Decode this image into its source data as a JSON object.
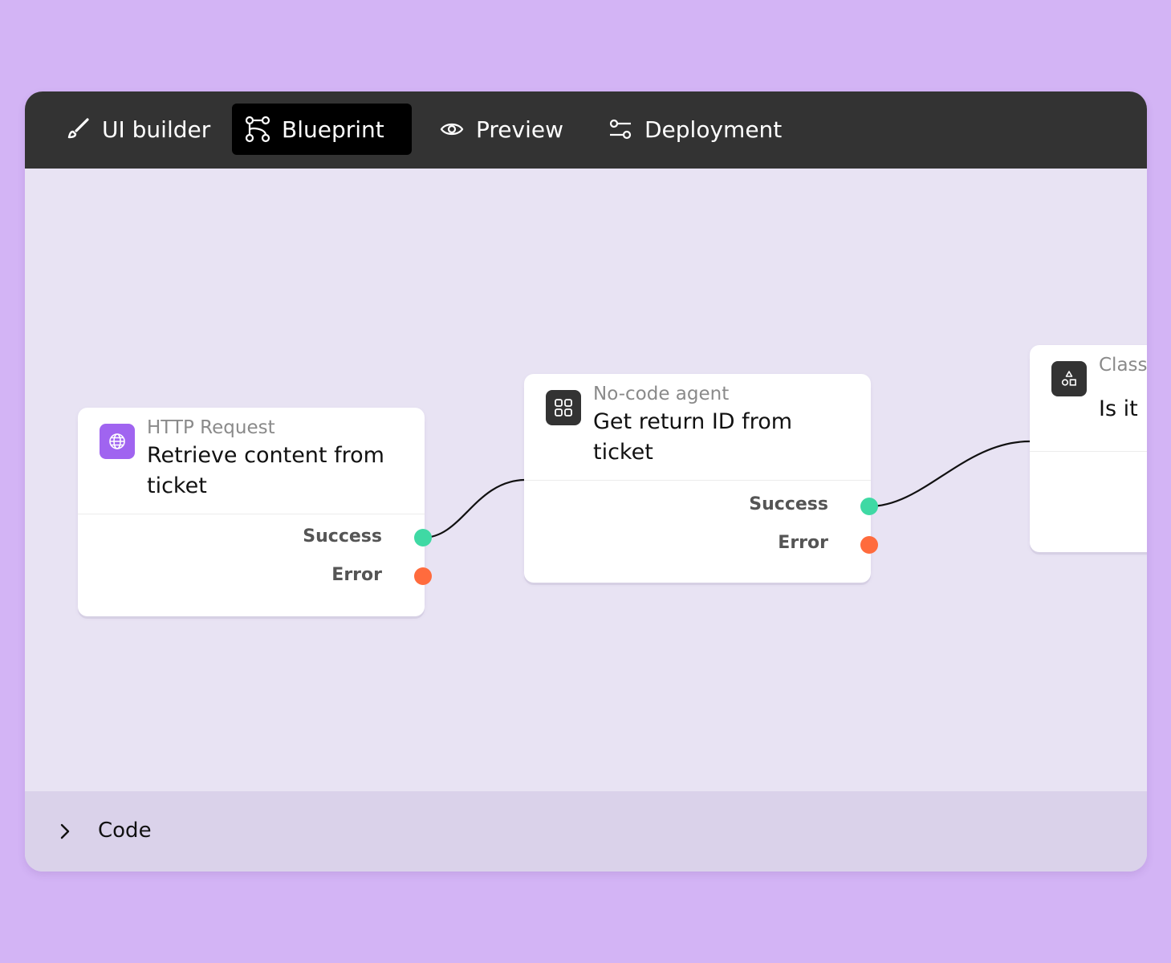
{
  "tabs": [
    {
      "label": "UI builder",
      "icon": "brush-icon"
    },
    {
      "label": "Blueprint",
      "icon": "flow-branch-icon",
      "active": true
    },
    {
      "label": "Preview",
      "icon": "eye-icon"
    },
    {
      "label": "Deployment",
      "icon": "sliders-icon"
    }
  ],
  "nodes": [
    {
      "type": "HTTP Request",
      "title": "Retrieve content from ticket",
      "icon": "globe-icon",
      "icon_color": "#a064f0",
      "ports": {
        "success": "Success",
        "error": "Error"
      }
    },
    {
      "type": "No-code agent",
      "title": "Get return ID from ticket",
      "icon": "grid-icon",
      "icon_color": "#333333",
      "ports": {
        "success": "Success",
        "error": "Error"
      }
    },
    {
      "type": "Class",
      "title": "Is it",
      "icon": "shapes-icon",
      "icon_color": "#333333"
    }
  ],
  "bottom": {
    "label": "Code",
    "icon": "chevron-right-icon"
  },
  "colors": {
    "success": "#3fd9a4",
    "error": "#ff6b3d",
    "background": "#d3b4f5",
    "topbar": "#333333"
  }
}
